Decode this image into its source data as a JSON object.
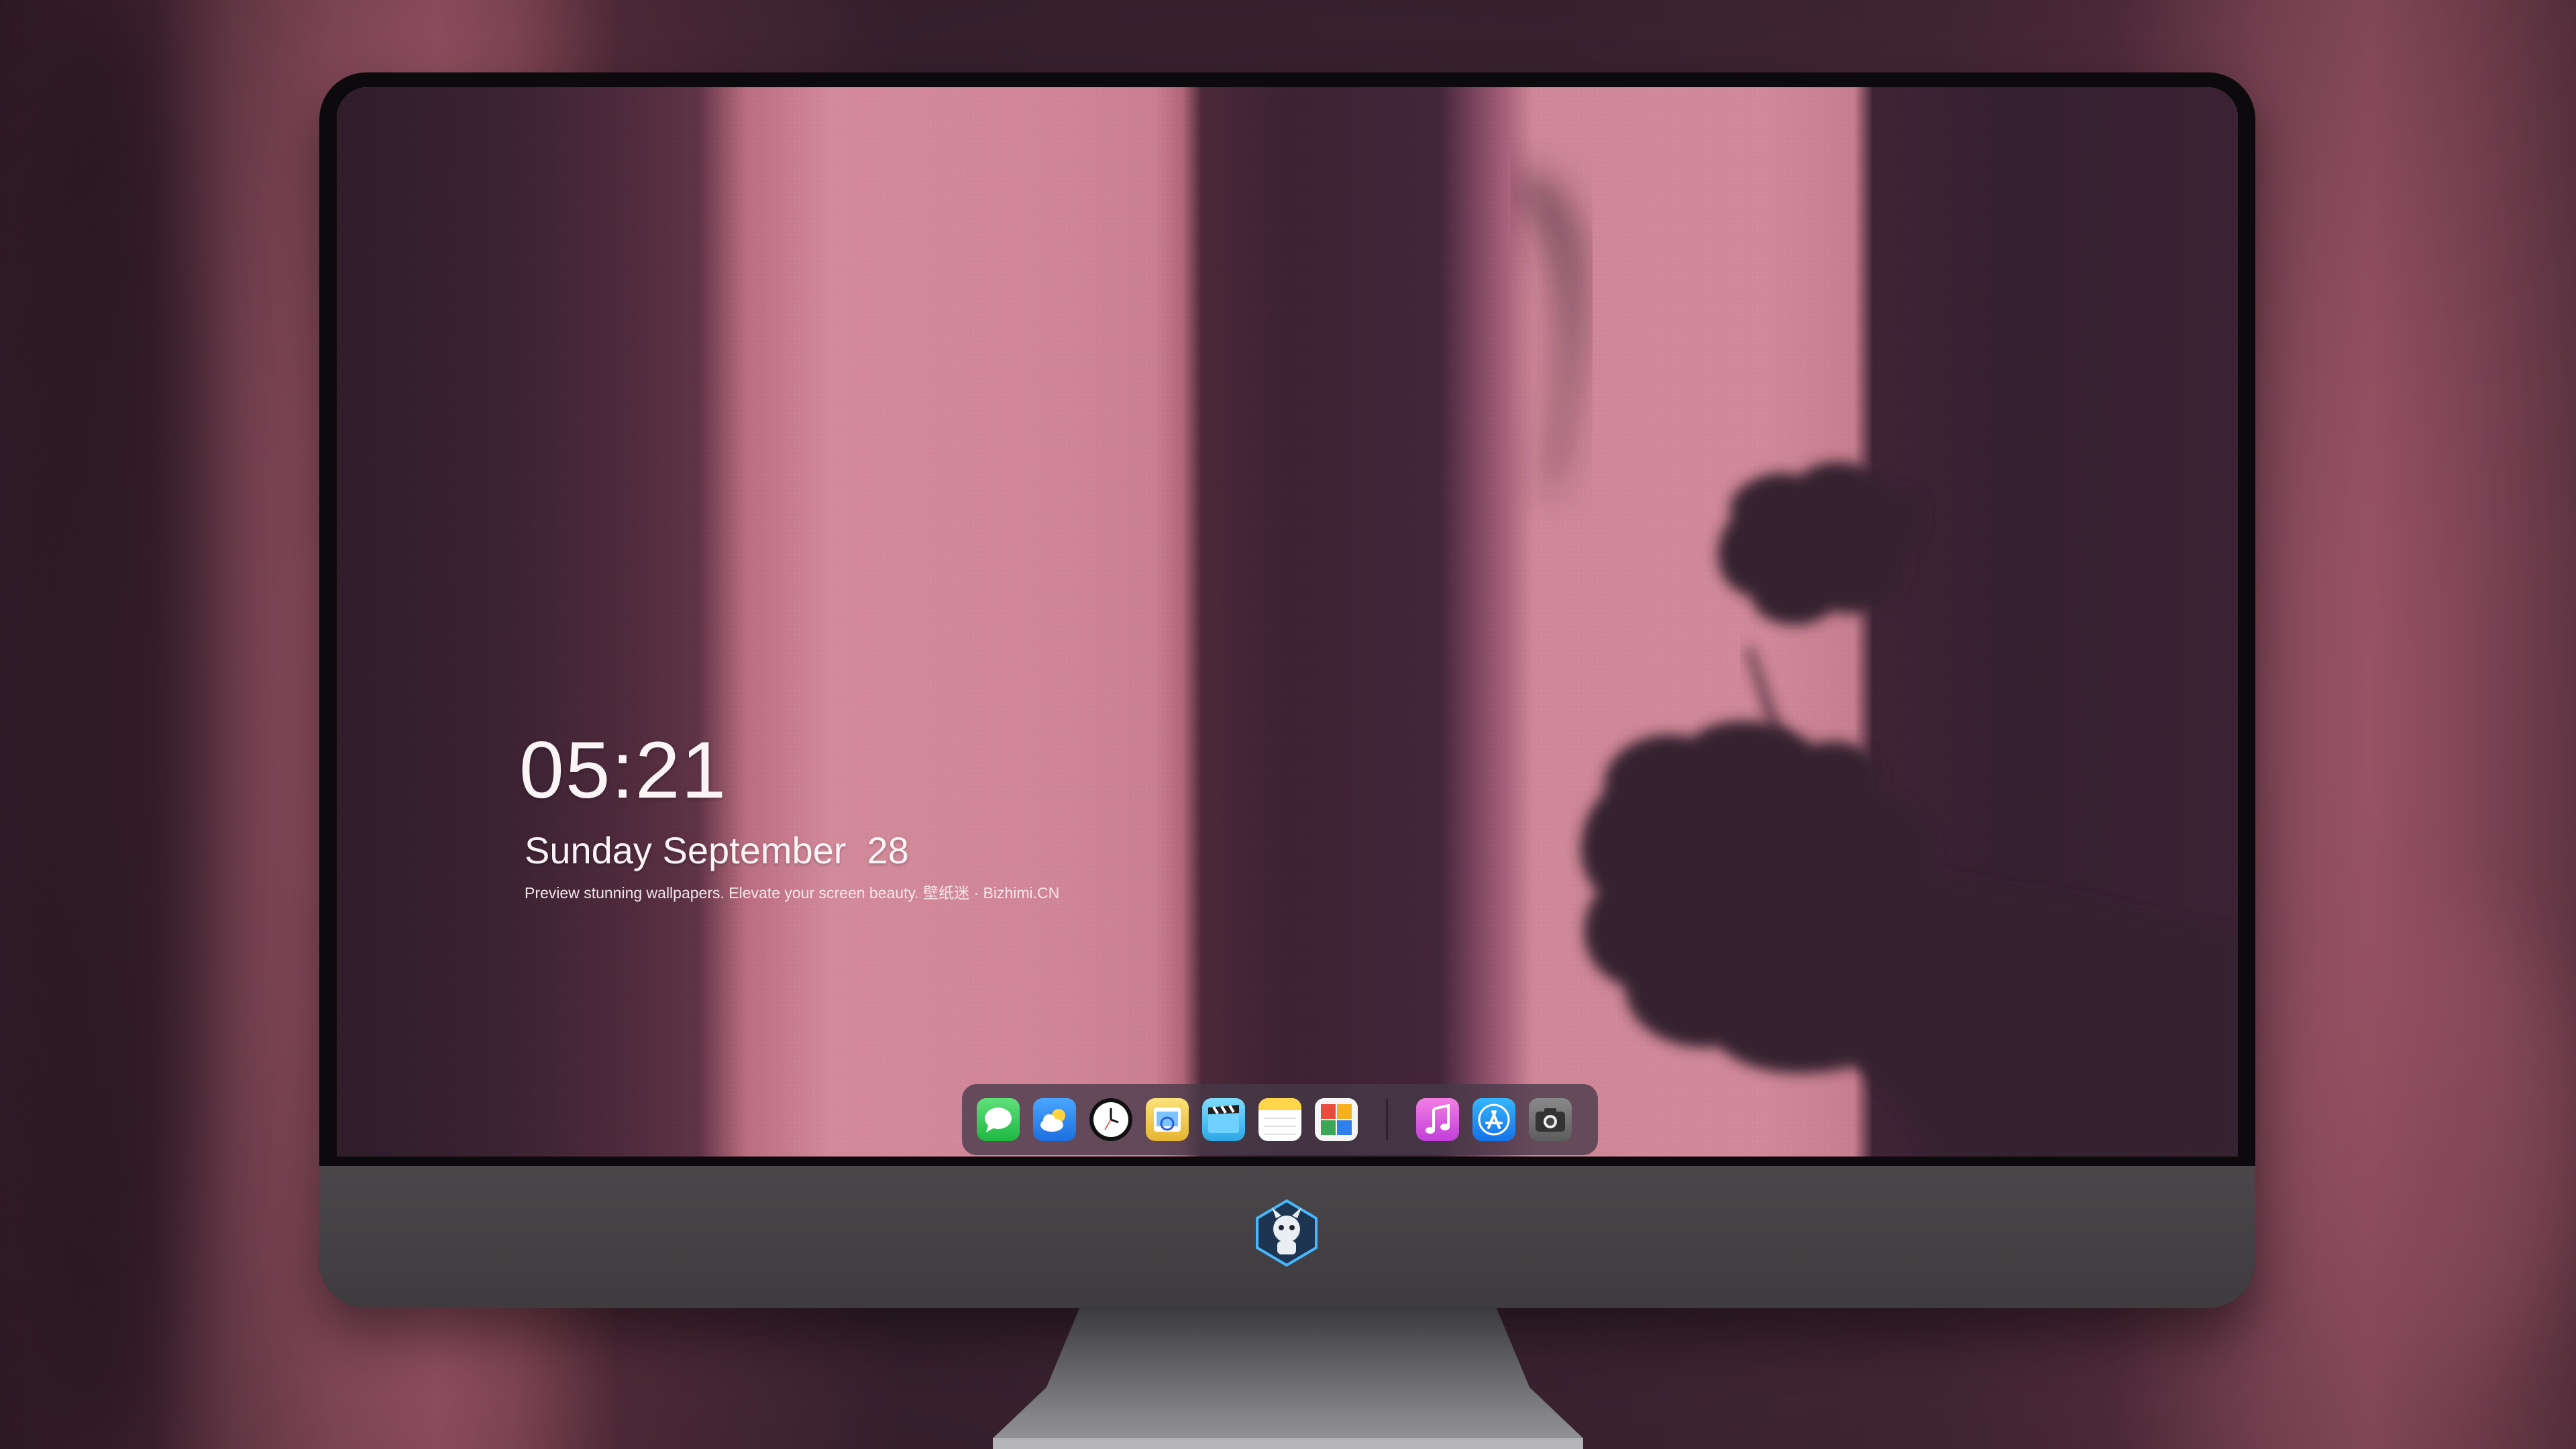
{
  "lockscreen": {
    "time": "05:21",
    "date": "Sunday September  28",
    "caption": "Preview stunning wallpapers. Elevate your screen beauty. 壁纸迷 · Bizhimi.CN"
  },
  "dock": {
    "apps": [
      {
        "icon": "messages-icon",
        "color": "#34c759"
      },
      {
        "icon": "weather-icon",
        "color": "#2f8ef7"
      },
      {
        "icon": "clock-icon",
        "color": "#111111"
      },
      {
        "icon": "preview-icon",
        "color": "#f4c542"
      },
      {
        "icon": "clips-icon",
        "color": "#5ac8fa"
      },
      {
        "icon": "notes-icon",
        "color": "#ffd54a"
      },
      {
        "icon": "photo-booth-icon",
        "color": "#e94b3c"
      },
      {
        "icon": "itunes-icon",
        "color": "#e94bd0"
      },
      {
        "icon": "app-store-icon",
        "color": "#1a8cff"
      },
      {
        "icon": "screenshot-icon",
        "color": "#6e6e6e"
      }
    ]
  },
  "colors": {
    "wallpaper_light": "#d08898",
    "wallpaper_dark": "#3a2233",
    "bezel": "#0c0a0c",
    "chin": "#4a4649"
  }
}
